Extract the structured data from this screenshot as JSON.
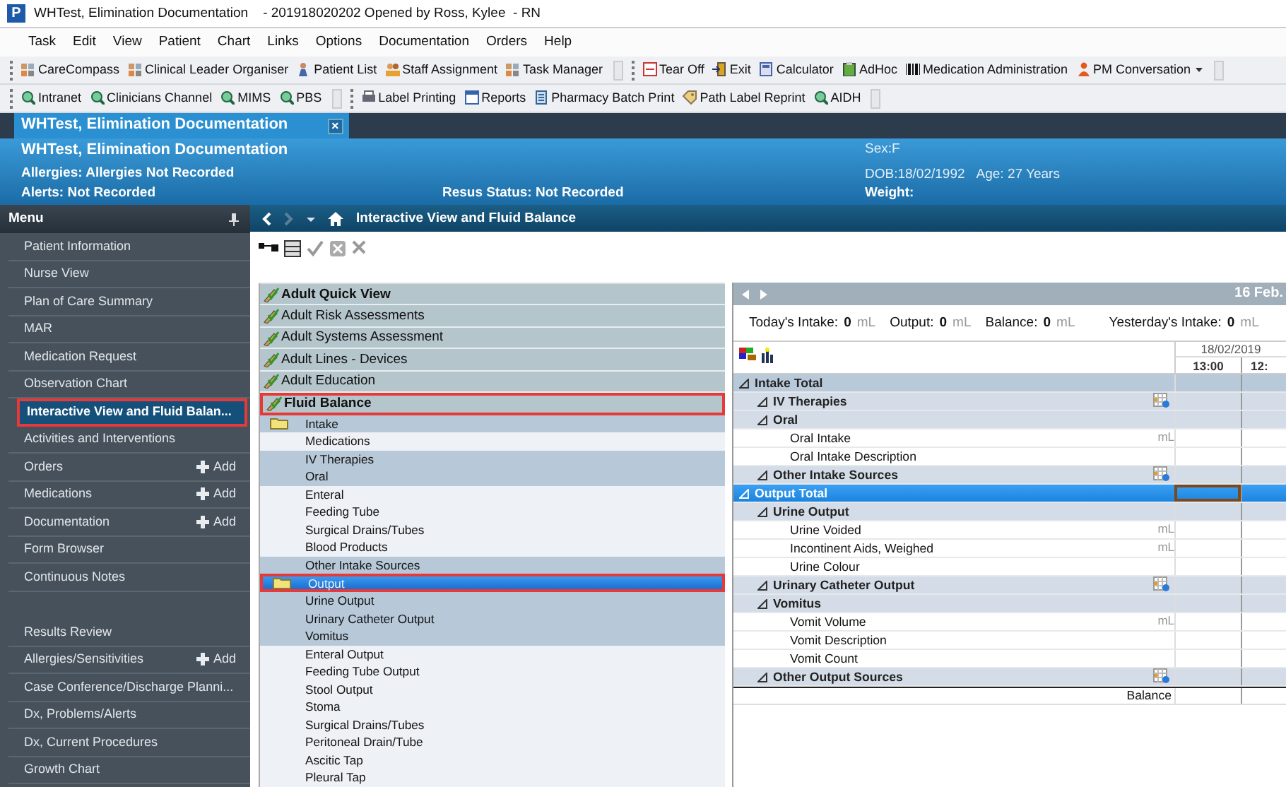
{
  "title_bar": {
    "app_letter": "P",
    "title": "WHTest, Elimination Documentation    - 201918020202 Opened by Ross, Kylee  - RN"
  },
  "menu_bar": [
    "Task",
    "Edit",
    "View",
    "Patient",
    "Chart",
    "Links",
    "Options",
    "Documentation",
    "Orders",
    "Help"
  ],
  "toolbars": [
    {
      "groups": [
        [
          {
            "label": "CareCompass",
            "kind": "grid"
          },
          {
            "label": "Clinical Leader Organiser",
            "kind": "grid"
          },
          {
            "label": "Patient List",
            "kind": "person"
          },
          {
            "label": "Staff Assignment",
            "kind": "people"
          },
          {
            "label": "Task Manager",
            "kind": "grid"
          }
        ],
        [
          {
            "label": "Tear Off",
            "kind": "tearoff"
          },
          {
            "label": "Exit",
            "kind": "exit"
          },
          {
            "label": "Calculator",
            "kind": "calculator"
          },
          {
            "label": "AdHoc",
            "kind": "adhoc"
          },
          {
            "label": "Medication Administration",
            "kind": "barcode"
          },
          {
            "label": "PM Conversation",
            "kind": "pm"
          }
        ]
      ]
    },
    {
      "groups": [
        [
          {
            "label": "Intranet",
            "kind": "globe"
          },
          {
            "label": "Clinicians Channel",
            "kind": "globe"
          },
          {
            "label": "MIMS",
            "kind": "globe"
          },
          {
            "label": "PBS",
            "kind": "globe"
          }
        ],
        [
          {
            "label": "Label Printing",
            "kind": "printer"
          },
          {
            "label": "Reports",
            "kind": "window"
          },
          {
            "label": "Pharmacy Batch Print",
            "kind": "document"
          },
          {
            "label": "Path Label Reprint",
            "kind": "tag"
          },
          {
            "label": "AIDH",
            "kind": "globe"
          }
        ]
      ]
    }
  ],
  "tabs": [
    {
      "label": "WHTest, Elimination Documentation",
      "close": "×",
      "selected": true
    }
  ],
  "banner": {
    "name": "WHTest, Elimination Documentation",
    "allergies": "Allergies: Allergies Not Recorded",
    "alerts": "Alerts: Not Recorded",
    "resus": "Resus Status: Not Recorded",
    "sex": "Sex:F",
    "dob": "DOB:18/02/1992",
    "age": "Age: 27 Years",
    "weight": "Weight:"
  },
  "menu": {
    "title": "Menu",
    "sections": [
      {
        "items": [
          {
            "label": "Patient Information",
            "selected": false
          },
          {
            "label": "Nurse View",
            "selected": false
          },
          {
            "label": "Plan of Care Summary",
            "selected": false
          },
          {
            "label": "MAR",
            "selected": false
          },
          {
            "label": "Medication Request",
            "selected": false
          },
          {
            "label": "Observation Chart",
            "selected": false
          },
          {
            "label": "Interactive View and Fluid Balan...",
            "selected": true
          },
          {
            "label": "Activities and Interventions",
            "selected": false
          },
          {
            "label": "Orders",
            "action": "Add",
            "selected": false
          },
          {
            "label": "Medications",
            "action": "Add",
            "selected": false
          },
          {
            "label": "Documentation",
            "action": "Add",
            "selected": false
          },
          {
            "label": "Form Browser",
            "selected": false
          },
          {
            "label": "Continuous Notes",
            "selected": false
          }
        ]
      },
      {
        "items": [
          {
            "label": "Results Review",
            "selected": false
          },
          {
            "label": "Allergies/Sensitivities",
            "action": "Add",
            "selected": false
          },
          {
            "label": "Case Conference/Discharge Planni...",
            "selected": false
          },
          {
            "label": "Dx, Problems/Alerts",
            "selected": false
          },
          {
            "label": "Dx, Current Procedures",
            "selected": false
          },
          {
            "label": "Growth Chart",
            "selected": false
          }
        ]
      }
    ]
  },
  "nav": {
    "title": "Interactive View and Fluid Balance"
  },
  "bands": [
    {
      "label": "Adult Quick View",
      "bold": true,
      "selected": false
    },
    {
      "label": "Adult Risk Assessments",
      "bold": false,
      "selected": false
    },
    {
      "label": "Adult Systems Assessment",
      "bold": false,
      "selected": false
    },
    {
      "label": "Adult Lines - Devices",
      "bold": false,
      "selected": false
    },
    {
      "label": "Adult Education",
      "bold": false,
      "selected": false
    },
    {
      "label": "Fluid Balance",
      "bold": true,
      "selected": true
    }
  ],
  "sections": [
    {
      "label": "Intake",
      "kind": "folder",
      "shaded": true,
      "selected": false
    },
    {
      "label": "Medications",
      "kind": "item",
      "shaded": false,
      "selected": false
    },
    {
      "label": "IV Therapies",
      "kind": "item",
      "shaded": true,
      "selected": false
    },
    {
      "label": "Oral",
      "kind": "item",
      "shaded": true,
      "selected": false
    },
    {
      "label": "Enteral",
      "kind": "item",
      "shaded": false,
      "selected": false
    },
    {
      "label": "Feeding Tube",
      "kind": "item",
      "shaded": false,
      "selected": false
    },
    {
      "label": "Surgical Drains/Tubes",
      "kind": "item",
      "shaded": false,
      "selected": false
    },
    {
      "label": "Blood Products",
      "kind": "item",
      "shaded": false,
      "selected": false
    },
    {
      "label": "Other Intake Sources",
      "kind": "item",
      "shaded": true,
      "selected": false
    },
    {
      "label": "Output",
      "kind": "folder",
      "shaded": true,
      "selected": true
    },
    {
      "label": "Urine Output",
      "kind": "item",
      "shaded": true,
      "selected": false
    },
    {
      "label": "Urinary Catheter Output",
      "kind": "item",
      "shaded": true,
      "selected": false
    },
    {
      "label": "Vomitus",
      "kind": "item",
      "shaded": true,
      "selected": false
    },
    {
      "label": "Enteral Output",
      "kind": "item",
      "shaded": false,
      "selected": false
    },
    {
      "label": "Feeding Tube Output",
      "kind": "item",
      "shaded": false,
      "selected": false
    },
    {
      "label": "Stool Output",
      "kind": "item",
      "shaded": false,
      "selected": false
    },
    {
      "label": "Stoma",
      "kind": "item",
      "shaded": false,
      "selected": false
    },
    {
      "label": "Surgical Drains/Tubes",
      "kind": "item",
      "shaded": false,
      "selected": false
    },
    {
      "label": "Peritoneal Drain/Tube",
      "kind": "item",
      "shaded": false,
      "selected": false
    },
    {
      "label": "Ascitic Tap",
      "kind": "item",
      "shaded": false,
      "selected": false
    },
    {
      "label": "Pleural Tap",
      "kind": "item",
      "shaded": false,
      "selected": false
    }
  ],
  "grid": {
    "period": "16 Feb.",
    "summary": [
      {
        "label": "Today's Intake:",
        "value": "0",
        "unit": "mL"
      },
      {
        "label": "Output:",
        "value": "0",
        "unit": "mL"
      },
      {
        "label": "Balance:",
        "value": "0",
        "unit": "mL"
      },
      {
        "label": "Yesterday's Intake:",
        "value": "0",
        "unit": "mL"
      }
    ],
    "date": "18/02/2019",
    "columns": [
      "13:00",
      "12:"
    ],
    "rows": [
      {
        "label": "Intake Total",
        "kind": "total",
        "selected": false,
        "children": [
          {
            "label": "IV Therapies",
            "kind": "dynamic",
            "selected": false
          },
          {
            "label": "Oral",
            "kind": "group",
            "selected": false,
            "children": [
              {
                "label": "Oral Intake",
                "kind": "item",
                "unit": "mL",
                "selected": false
              },
              {
                "label": "Oral Intake Description",
                "kind": "item",
                "selected": false
              }
            ]
          },
          {
            "label": "Other Intake Sources",
            "kind": "dynamic",
            "selected": false
          }
        ]
      },
      {
        "label": "Output Total",
        "kind": "total",
        "selected": true,
        "children": [
          {
            "label": "Urine Output",
            "kind": "group",
            "selected": false,
            "children": [
              {
                "label": "Urine Voided",
                "kind": "item",
                "unit": "mL",
                "selected": false
              },
              {
                "label": "Incontinent Aids, Weighed",
                "kind": "item",
                "unit": "mL",
                "selected": false
              },
              {
                "label": "Urine Colour",
                "kind": "item",
                "selected": false
              }
            ]
          },
          {
            "label": "Urinary Catheter Output",
            "kind": "dynamic",
            "selected": false
          },
          {
            "label": "Vomitus",
            "kind": "group",
            "selected": false,
            "children": [
              {
                "label": "Vomit Volume",
                "kind": "item",
                "unit": "mL",
                "selected": false
              },
              {
                "label": "Vomit Description",
                "kind": "item",
                "selected": false
              },
              {
                "label": "Vomit Count",
                "kind": "item",
                "selected": false
              }
            ]
          },
          {
            "label": "Other Output Sources",
            "kind": "dynamic",
            "selected": false
          }
        ]
      }
    ],
    "balance": "Balance"
  }
}
